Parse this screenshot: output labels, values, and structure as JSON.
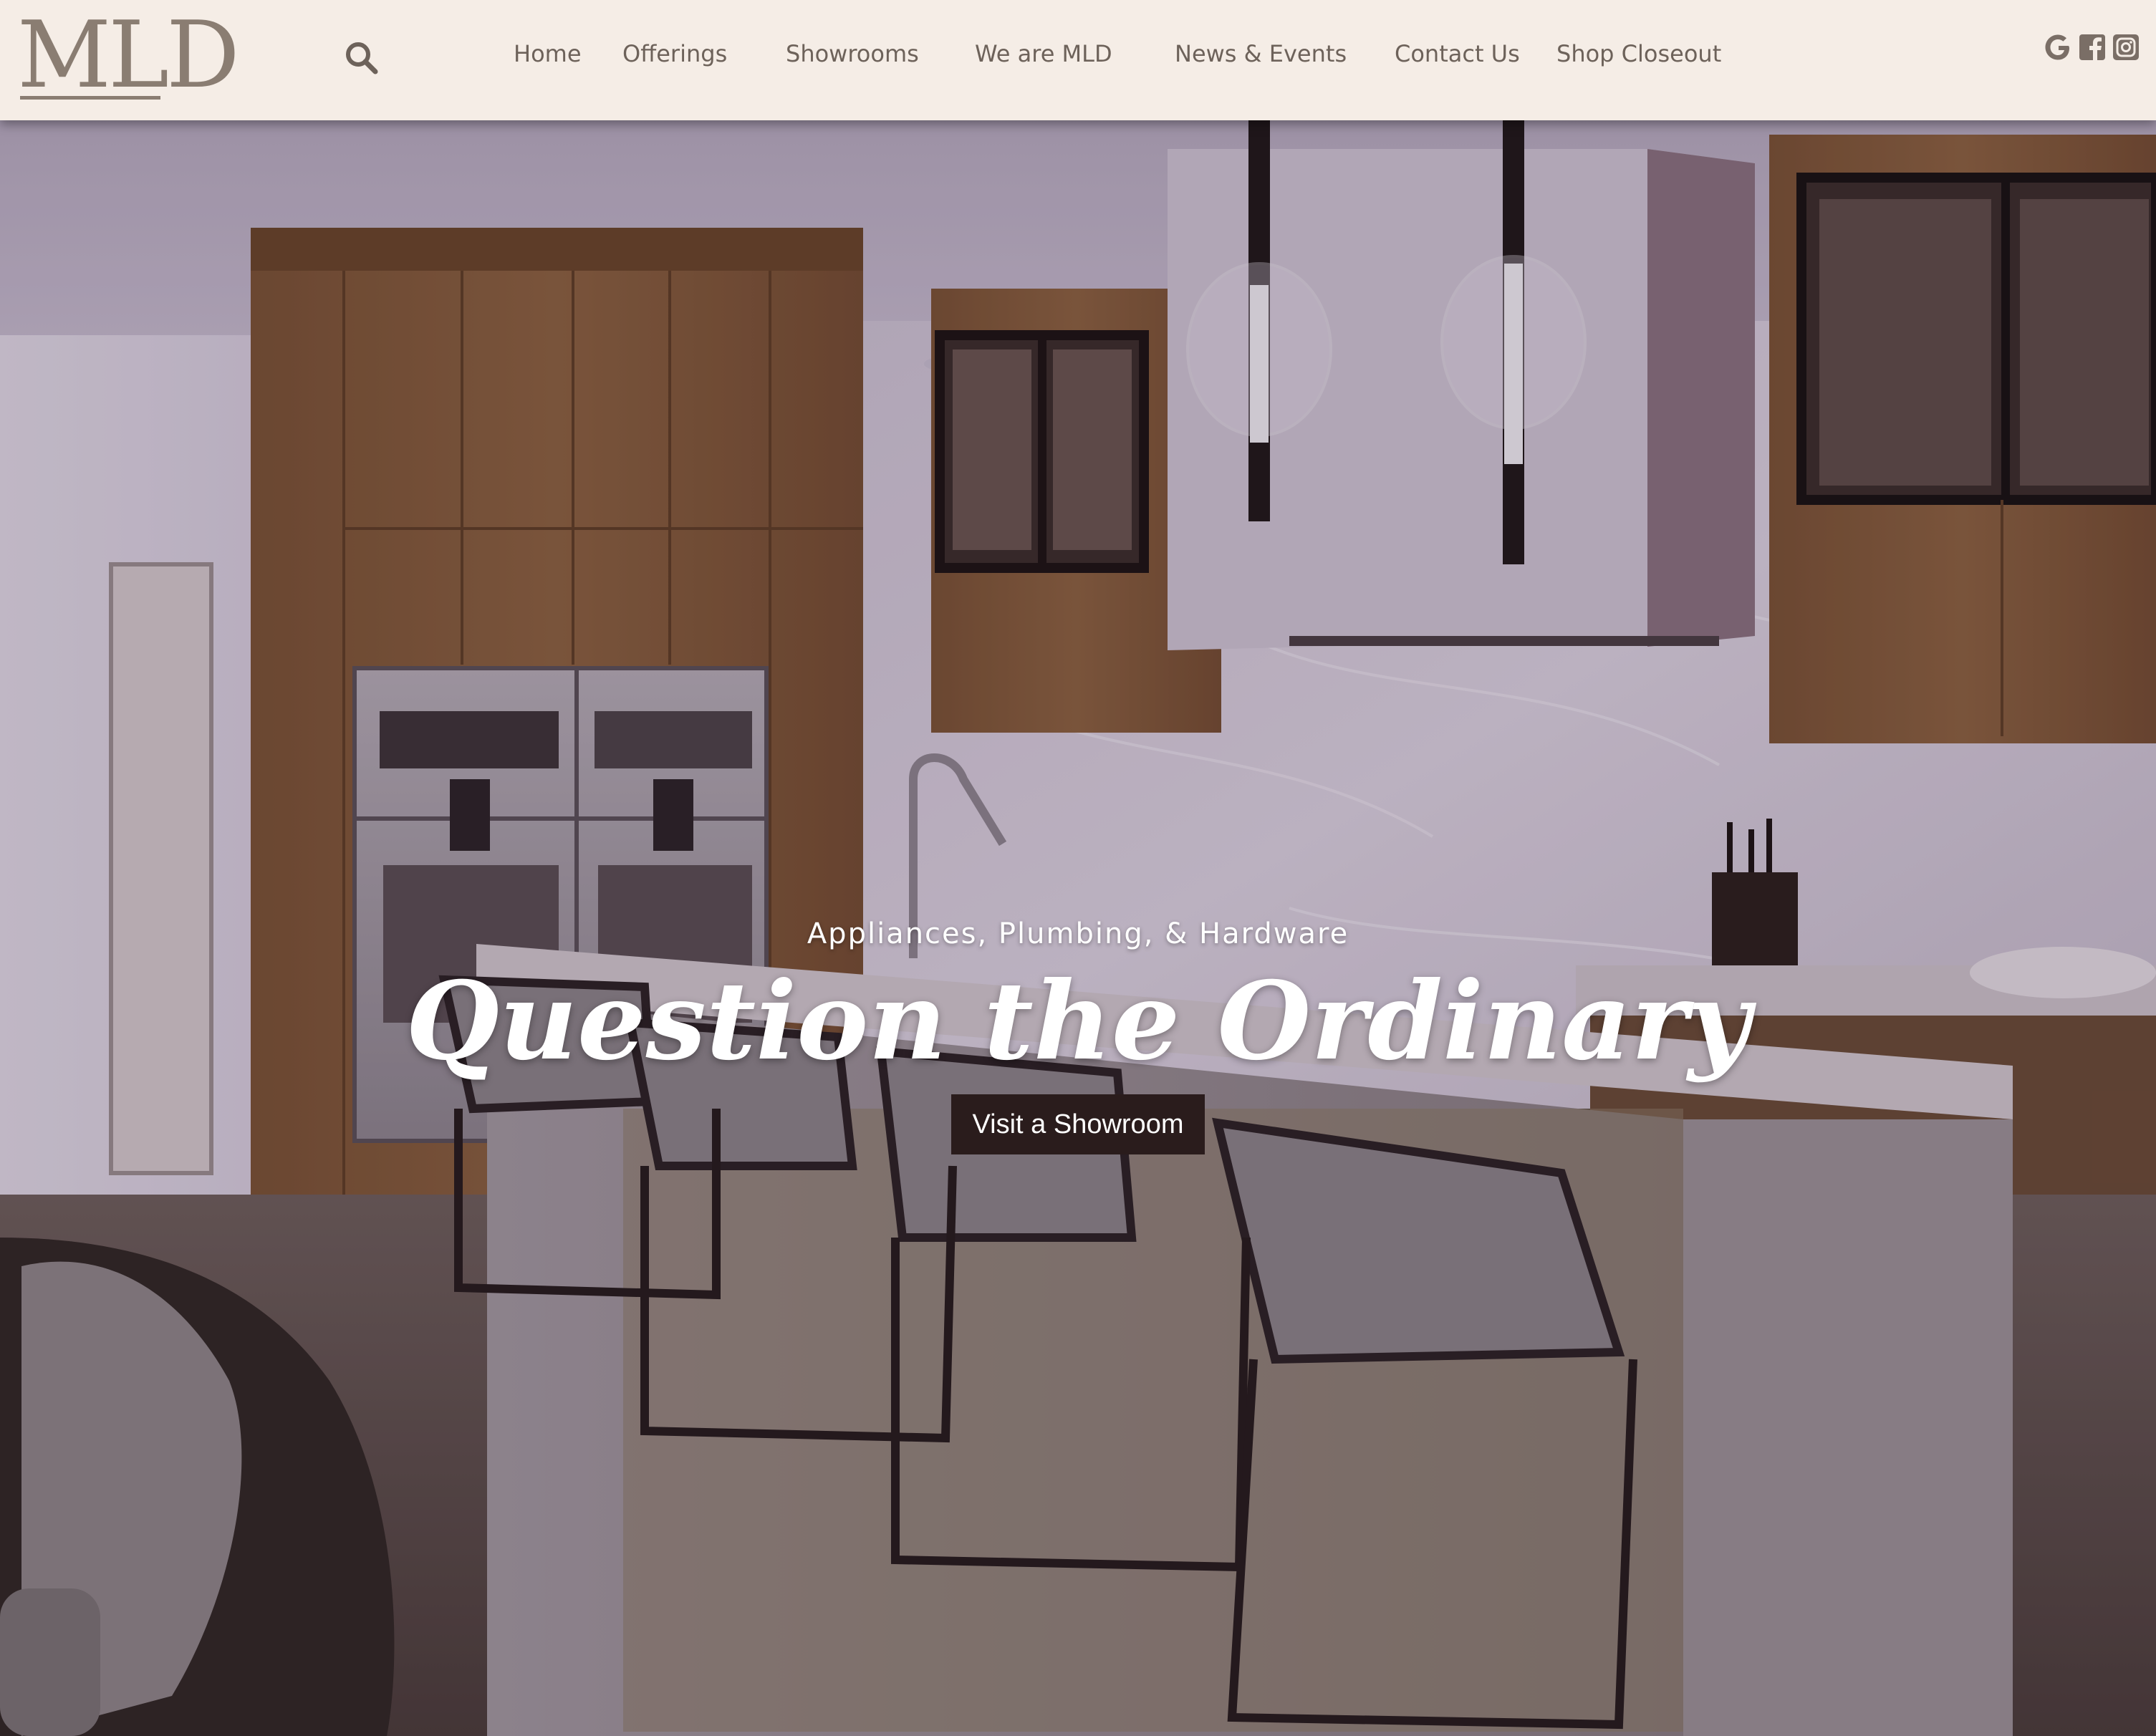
{
  "brand": {
    "logo_text": "MLD"
  },
  "header": {
    "search_icon": "search-icon",
    "nav": [
      {
        "label": "Home"
      },
      {
        "label": "Offerings"
      },
      {
        "label": "Showrooms"
      },
      {
        "label": "We are MLD"
      },
      {
        "label": "News & Events"
      },
      {
        "label": "Contact Us"
      },
      {
        "label": "Shop Closeout"
      }
    ],
    "social": [
      {
        "icon": "google-icon"
      },
      {
        "icon": "facebook-icon"
      },
      {
        "icon": "instagram-icon"
      }
    ]
  },
  "hero": {
    "subtitle": "Appliances, Plumbing, & Hardware",
    "headline": "Question the Ordinary",
    "cta_label": "Visit a Showroom"
  },
  "colors": {
    "header_bg": "#f5ede6",
    "nav_text": "#6d625a",
    "logo": "#8a7d72",
    "cta_bg": "#2a1c1c",
    "hero_text": "#ffffff"
  }
}
